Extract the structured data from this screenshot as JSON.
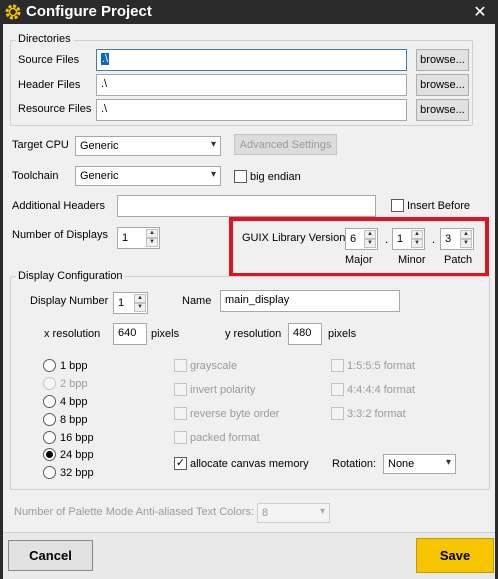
{
  "window": {
    "title": "Configure Project",
    "close_glyph": "✕"
  },
  "directories": {
    "legend": "Directories",
    "rows": [
      {
        "label": "Source Files",
        "value": ".\\",
        "button": "browse..."
      },
      {
        "label": "Header Files",
        "value": ".\\",
        "button": "browse..."
      },
      {
        "label": "Resource Files",
        "value": ".\\",
        "button": "browse..."
      }
    ]
  },
  "target_cpu": {
    "label": "Target CPU",
    "value": "Generic",
    "advanced_button": "Advanced Settings"
  },
  "toolchain": {
    "label": "Toolchain",
    "value": "Generic",
    "big_endian_label": "big endian",
    "big_endian_checked": false
  },
  "additional_headers": {
    "label": "Additional Headers",
    "value": "",
    "insert_before_label": "Insert Before"
  },
  "number_of_displays": {
    "label": "Number of Displays",
    "value": "1"
  },
  "guix_version": {
    "label": "GUIX Library Version",
    "major": "6",
    "minor": "1",
    "patch": "3",
    "major_label": "Major",
    "minor_label": "Minor",
    "patch_label": "Patch",
    "separator": "."
  },
  "display_config": {
    "legend": "Display Configuration",
    "display_number_label": "Display Number",
    "display_number": "1",
    "name_label": "Name",
    "name_value": "main_display",
    "x_res_label": "x resolution",
    "x_res": "640",
    "y_res_label": "y resolution",
    "y_res": "480",
    "pixels_label": "pixels",
    "bpp": [
      {
        "label": "1 bpp",
        "enabled": true,
        "selected": false
      },
      {
        "label": "2 bpp",
        "enabled": false,
        "selected": false
      },
      {
        "label": "4 bpp",
        "enabled": true,
        "selected": false
      },
      {
        "label": "8 bpp",
        "enabled": true,
        "selected": false
      },
      {
        "label": "16 bpp",
        "enabled": true,
        "selected": false
      },
      {
        "label": "24 bpp",
        "enabled": true,
        "selected": true
      },
      {
        "label": "32 bpp",
        "enabled": true,
        "selected": false
      }
    ],
    "options": [
      {
        "label": "grayscale",
        "checked": false
      },
      {
        "label": "invert polarity",
        "checked": false
      },
      {
        "label": "reverse byte order",
        "checked": false
      },
      {
        "label": "packed format",
        "checked": false
      },
      {
        "label": "allocate canvas memory",
        "checked": true
      }
    ],
    "formats": [
      {
        "label": "1:5:5:5 format"
      },
      {
        "label": "4:4:4:4 format"
      },
      {
        "label": "3:3:2 format"
      }
    ],
    "rotation_label": "Rotation:",
    "rotation_value": "None"
  },
  "palette": {
    "label": "Number of Palette Mode Anti-aliased Text Colors:",
    "value": "8"
  },
  "footer": {
    "cancel": "Cancel",
    "save": "Save"
  },
  "colors": {
    "save_bg": "#f6c500",
    "highlight_box": "#e0141e",
    "title_bar": "#2b2b2b"
  }
}
